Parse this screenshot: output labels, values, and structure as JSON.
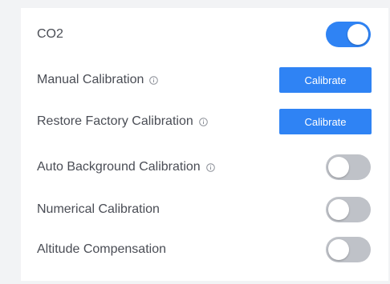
{
  "settings": {
    "rows": [
      {
        "label": "CO2",
        "control": "toggle",
        "state": "on"
      },
      {
        "label": "Manual Calibration",
        "control": "button",
        "button_label": "Calibrate",
        "info_icon": "info-icon"
      },
      {
        "label": "Restore Factory Calibration",
        "control": "button",
        "button_label": "Calibrate",
        "info_icon": "info-icon"
      },
      {
        "label": "Auto Background Calibration",
        "control": "toggle",
        "state": "off",
        "info_icon": "info-icon"
      },
      {
        "label": "Numerical Calibration",
        "control": "toggle",
        "state": "off"
      },
      {
        "label": "Altitude Compensation",
        "control": "toggle",
        "state": "off"
      }
    ]
  },
  "colors": {
    "accent": "#2f83f4",
    "toggle_off": "#bfc2c8",
    "label_text": "#4a4d55",
    "background": "#f2f3f5",
    "card": "#ffffff"
  }
}
